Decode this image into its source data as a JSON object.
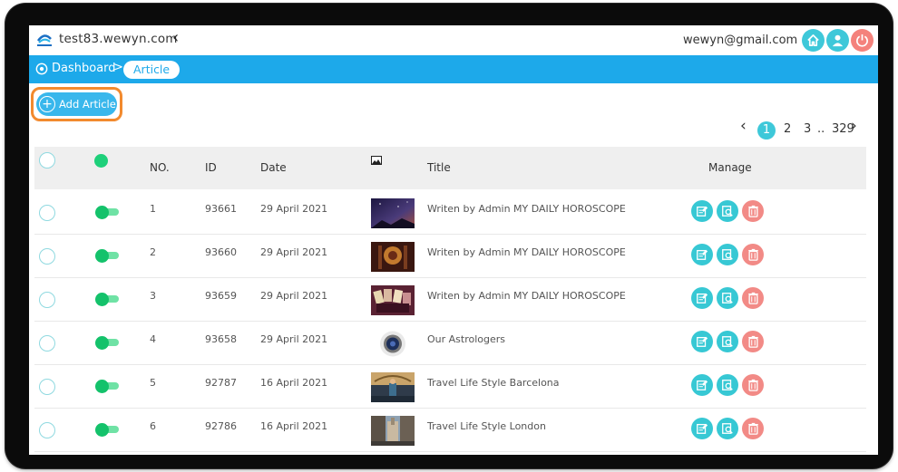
{
  "header": {
    "site": "test83.wewyn.com",
    "user_email": "wewyn@gmail.com"
  },
  "breadcrumb": {
    "home": "Dashboard",
    "separator": ">",
    "current": "Article"
  },
  "toolbar": {
    "add_label": "Add Article"
  },
  "pagination": {
    "pages": [
      "1",
      "2",
      "3"
    ],
    "ellipsis": "..",
    "last": "329",
    "current": "1"
  },
  "table": {
    "columns": {
      "no": "NO.",
      "id": "ID",
      "date": "Date",
      "title": "Title",
      "manage": "Manage"
    },
    "rows": [
      {
        "no": "1",
        "id": "93661",
        "date": "29 April 2021",
        "title": "Writen by Admin MY DAILY HOROSCOPE",
        "thumb": "night-sky"
      },
      {
        "no": "2",
        "id": "93660",
        "date": "29 April 2021",
        "title": "Writen by Admin MY DAILY HOROSCOPE",
        "thumb": "mystic"
      },
      {
        "no": "3",
        "id": "93659",
        "date": "29 April 2021",
        "title": "Writen by Admin MY DAILY HOROSCOPE",
        "thumb": "tarot"
      },
      {
        "no": "4",
        "id": "93658",
        "date": "29 April 2021",
        "title": "Our Astrologers",
        "thumb": "ring"
      },
      {
        "no": "5",
        "id": "92787",
        "date": "16 April 2021",
        "title": "Travel Life Style Barcelona",
        "thumb": "barcelona"
      },
      {
        "no": "6",
        "id": "92786",
        "date": "16 April 2021",
        "title": "Travel Life Style London",
        "thumb": "london"
      }
    ]
  },
  "colors": {
    "accent": "#1da9ea",
    "teal": "#3ec8d9",
    "danger": "#f28a86",
    "highlight": "#f28a2e",
    "toggle_on": "#14c26b"
  }
}
